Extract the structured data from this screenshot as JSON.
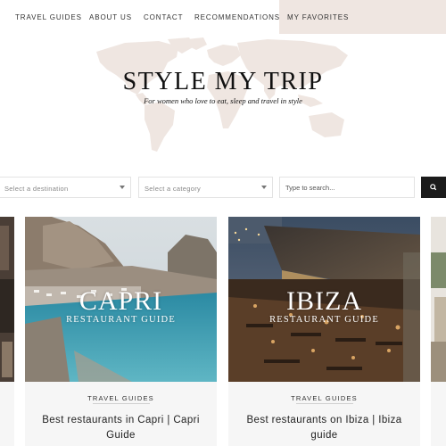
{
  "nav": {
    "items": [
      "TRAVEL GUIDES",
      "ABOUT US",
      "CONTACT",
      "RECOMMENDATIONS"
    ],
    "favorites": "MY FAVORITES"
  },
  "hero": {
    "title": "STYLE MY TRIP",
    "tagline": "For women who love to eat, sleep and travel in style"
  },
  "filters": {
    "destination_placeholder": "Select a destination",
    "category_placeholder": "Select a category",
    "search_placeholder": "Type to search...",
    "search_icon": "search-icon"
  },
  "cards": [
    {
      "image_title": "CAPRI",
      "image_subtitle": "RESTAURANT GUIDE",
      "category": "TRAVEL GUIDES",
      "title": "Best restaurants in Capri | Capri Guide"
    },
    {
      "image_title": "IBIZA",
      "image_subtitle": "RESTAURANT GUIDE",
      "category": "TRAVEL GUIDES",
      "title": "Best restaurants on Ibiza | Ibiza guide"
    }
  ],
  "colors": {
    "nav_favorites_bg": "#efe6e1",
    "map": "#efe6e1",
    "search_button": "#1b1b1b",
    "card_bg": "#f6f6f6"
  }
}
